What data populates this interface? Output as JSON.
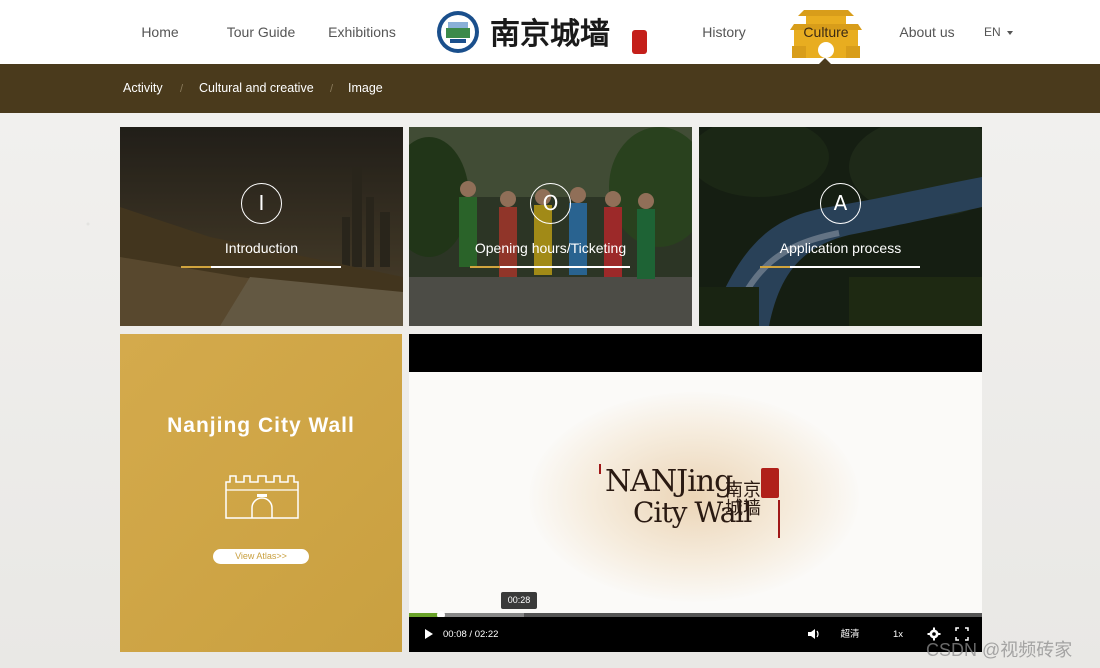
{
  "nav": {
    "home": "Home",
    "tour_guide": "Tour Guide",
    "exhibitions": "Exhibitions",
    "history": "History",
    "culture": "Culture",
    "about": "About us",
    "lang": "EN",
    "logo_text": "南京城墙"
  },
  "subnav": {
    "items": [
      "Activity",
      "Cultural and creative",
      "Image"
    ],
    "separator": "/"
  },
  "cards": [
    {
      "letter": "I",
      "label": "Introduction"
    },
    {
      "letter": "O",
      "label": "Opening hours/Ticketing"
    },
    {
      "letter": "A",
      "label": "Application process"
    }
  ],
  "promo": {
    "title": "Nanjing City Wall",
    "button": "View Atlas>>"
  },
  "video": {
    "title_line1": "NANJing",
    "title_line2": "City Wall",
    "title_cn": "南京城墙",
    "tooltip": "00:28",
    "time": "00:08 / 02:22",
    "quality": "超清",
    "speed": "1x",
    "progress": 0.056,
    "buffered": 0.2
  },
  "watermark": "CSDN @视频砖家",
  "colors": {
    "brown": "#4a3a1c",
    "gold": "#c9a040",
    "accent": "#d1a43e"
  }
}
